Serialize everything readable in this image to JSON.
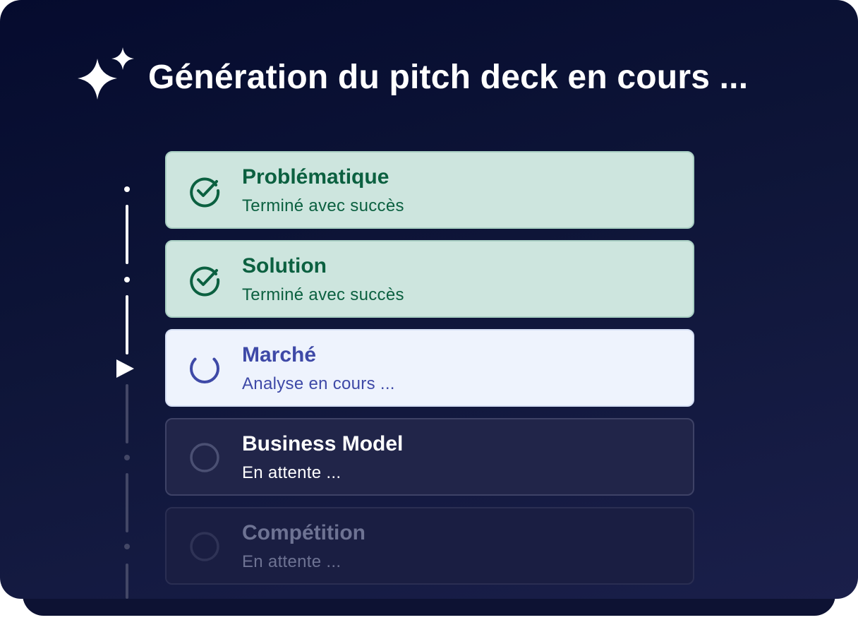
{
  "header": {
    "sparkle_icon": "sparkle-icon",
    "title": "Génération du pitch deck en cours ..."
  },
  "steps": [
    {
      "title": "Problématique",
      "status_text": "Terminé avec succès",
      "state": "done",
      "icon": "check-circle-icon"
    },
    {
      "title": "Solution",
      "status_text": "Terminé avec succès",
      "state": "done",
      "icon": "check-circle-icon"
    },
    {
      "title": "Marché",
      "status_text": "Analyse en cours ...",
      "state": "active",
      "icon": "spinner-icon"
    },
    {
      "title": "Business Model",
      "status_text": "En attente ...",
      "state": "pending",
      "icon": "empty-circle-icon"
    },
    {
      "title": "Compétition",
      "status_text": "En attente ...",
      "state": "pending",
      "icon": "empty-circle-icon"
    }
  ],
  "colors": {
    "background": "#0e1538",
    "done_bg": "#cde5de",
    "done_text": "#0b6040",
    "active_bg": "#eef3fd",
    "active_text": "#3e49a7",
    "pending_bg": "#212549"
  }
}
